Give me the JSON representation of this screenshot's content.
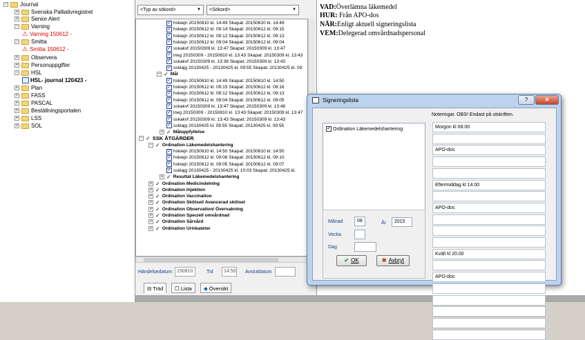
{
  "journal_tree": {
    "root": "Journal",
    "items": [
      {
        "label": "Svenska Palliativregistret",
        "expand": "+"
      },
      {
        "label": "Senior Alert",
        "expand": "+"
      },
      {
        "label": "Varning",
        "expand": "−"
      },
      {
        "label": "Varning 150612 -",
        "child": true,
        "alert": true
      },
      {
        "label": "Smitta",
        "expand": "−"
      },
      {
        "label": "Smitta 150612 -",
        "child": true,
        "alert": true
      },
      {
        "label": "Observera",
        "expand": "+"
      },
      {
        "label": "Personuppgifter",
        "expand": "+"
      },
      {
        "label": "HSL",
        "expand": "−"
      },
      {
        "label": "HSL- journal 120423 -",
        "child": true
      },
      {
        "label": "Plan",
        "expand": "+"
      },
      {
        "label": "FASS",
        "expand": "+"
      },
      {
        "label": "PASCAL",
        "expand": "+"
      },
      {
        "label": "Beställningsportalen",
        "expand": "+"
      },
      {
        "label": "LSS",
        "expand": "+"
      },
      {
        "label": "SOL",
        "expand": "+"
      }
    ]
  },
  "middle": {
    "type_combo": "<Typ av sökord>",
    "search_combo": "<Sökord>",
    "rows": [
      {
        "label": "hskiejn 20150810 kl. 14:49  Skapat: 20150810 kl. 14:49",
        "kind": "entry",
        "indent": 1
      },
      {
        "label": "hskiejn 20150612 kl. 09:14  Skapat: 20150612 kl. 09:15",
        "kind": "entry",
        "indent": 1
      },
      {
        "label": "hskiejn 20150612 kl. 09:12  Skapat: 20150612 kl. 09:13",
        "kind": "entry",
        "indent": 1
      },
      {
        "label": "hskiejn 20150612 kl. 09:04  Skapat: 20150612 kl. 09:04",
        "kind": "entry",
        "indent": 1
      },
      {
        "label": "sskakvf 20150309 kl. 13:47  Skapat: 20150309 kl. 13:47",
        "kind": "entry",
        "indent": 1
      },
      {
        "label": "irwg 20150309 - 20150810 kl. 13:43  Skapat: 20150309 kl. 13:43",
        "kind": "entry",
        "indent": 1
      },
      {
        "label": "sskakvf 20150309 kl. 13:38  Skapat: 20150309 kl. 13:43",
        "kind": "entry",
        "indent": 1
      },
      {
        "label": "ssklajg 20130425 - 20130425 kl. 09:55  Skapat: 20130425 kl. 09:",
        "kind": "entry",
        "indent": 1
      },
      {
        "label": "Mål",
        "kind": "group",
        "indent": 0
      },
      {
        "label": "hskiejn 20150810 kl. 14:49  Skapat: 20150810 kl. 14:50",
        "kind": "entry",
        "indent": 1
      },
      {
        "label": "hskiejn 20150612 kl. 09:15  Skapat: 20150612 kl. 09:16",
        "kind": "entry",
        "indent": 1
      },
      {
        "label": "hskiejn 20150612 kl. 09:12  Skapat: 20150612 kl. 09:13",
        "kind": "entry",
        "indent": 1
      },
      {
        "label": "hskiejn 20150612 kl. 09:04  Skapat: 20150612 kl. 09:05",
        "kind": "entry",
        "indent": 1
      },
      {
        "label": "sskakvf 20150309 kl. 13:47  Skapat: 20150309 kl. 13:48",
        "kind": "entry",
        "indent": 1
      },
      {
        "label": "irwg 20150309 - 20150810 kl. 13:43  Skapat: 20150309 kl. 13:47",
        "kind": "entry",
        "indent": 1
      },
      {
        "label": "sskakvf 20150309 kl. 13:43  Skapat: 20150309 kl. 13:43",
        "kind": "entry",
        "indent": 1
      },
      {
        "label": "ssklajg 20130425 kl. 09:55  Skapat: 20130425 kl. 09:55",
        "kind": "entry",
        "indent": 1
      },
      {
        "label": "Måluppfyllelse",
        "kind": "group",
        "indent": 1
      },
      {
        "label": "SSK ÅTGÄRDER",
        "kind": "section",
        "indent": -1
      },
      {
        "label": "Ordination Läkemedelshantering",
        "kind": "order",
        "indent": 0
      },
      {
        "label": "hskiejn 20150810 kl. 14:50  Skapat: 20150810 kl. 14:50",
        "kind": "entry",
        "indent": 1
      },
      {
        "label": "hskiejn 20150612 kl. 09:08  Skapat: 20150612 kl. 09:10",
        "kind": "entry",
        "indent": 1
      },
      {
        "label": "hskiejn 20150612 kl. 09:05  Skapat: 20150612 kl. 09:07",
        "kind": "entry",
        "indent": 1
      },
      {
        "label": "ssklajg 20130425 - 20130425 kl. 10:03  Skapat: 20130425 kl.",
        "kind": "entry",
        "indent": 1
      },
      {
        "label": "Resultat  Läkemedelshantering",
        "kind": "group",
        "indent": 1
      },
      {
        "label": "Ordination Medicindelning",
        "kind": "order",
        "indent": 0
      },
      {
        "label": "Ordination Injektion",
        "kind": "order",
        "indent": 0
      },
      {
        "label": "Ordination Vaccination",
        "kind": "order",
        "indent": 0
      },
      {
        "label": "Ordination Skötsel/ Avancerad skötsel",
        "kind": "order",
        "indent": 0
      },
      {
        "label": "Ordination Observation/ Övervakning",
        "kind": "order",
        "indent": 0
      },
      {
        "label": "Ordination Speciell omvårdnad",
        "kind": "order",
        "indent": 0
      },
      {
        "label": "Ordination Sårvård",
        "kind": "order",
        "indent": 0
      },
      {
        "label": "Ordination Urinkateter",
        "kind": "order",
        "indent": 0
      }
    ],
    "event_date_label": "Händelsedatum",
    "event_date_value": "150810",
    "time_label": "Tid",
    "time_value": "14:50",
    "end_date_label": "Avslutdatum",
    "end_date_value": "",
    "tabs": [
      "Träd",
      "Lista",
      "Översikt"
    ]
  },
  "right_panel": {
    "lines": [
      {
        "key": "VAD:",
        "value": "Överlämna läkemedel"
      },
      {
        "key": "HUR:",
        "value": " Från APO-dos"
      },
      {
        "key": "NÄR:",
        "value": "Enligt aktuell signeringslista"
      },
      {
        "key": "VEM:",
        "value": "Delegerad omvårdnadspersonal"
      }
    ]
  },
  "dialog": {
    "title": "Signeringslista",
    "help_button": "?",
    "close_button": "✕",
    "list_items": [
      "Ordination Läkemedelshantering"
    ],
    "month_label": "Månad",
    "month_value": "08",
    "year_label": "År",
    "year_value": "2015",
    "week_label": "Vecka",
    "week_value": "",
    "day_label": "Dag",
    "day_value": "",
    "ok_button": "OK",
    "cancel_button": "Avbryt",
    "notes_header": "Noteringar. OBS! Endast på utskriften.",
    "notes": [
      "Morgon kl 08.00",
      "",
      "APO-dos",
      "",
      "",
      "Eftermiddag kl 14.00",
      "",
      "APO-dos",
      "",
      "",
      "",
      "Kväll kl 20.00",
      "",
      "APO-dos",
      "",
      "",
      "",
      "",
      ""
    ]
  }
}
